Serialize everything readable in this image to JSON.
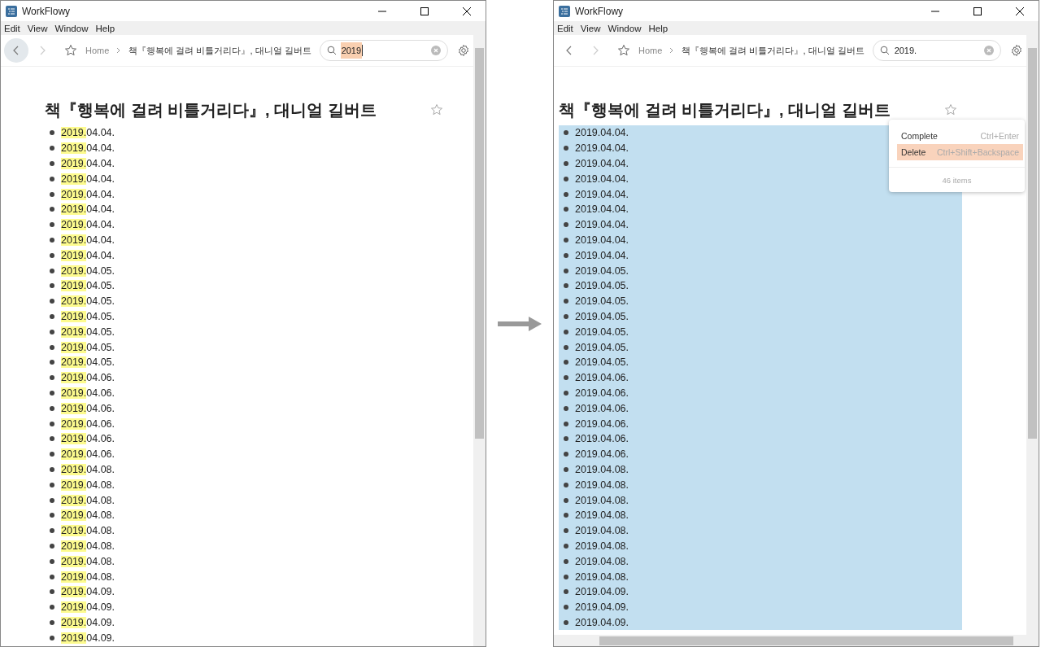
{
  "windows": [
    {
      "title": "WorkFlowy",
      "menu": [
        "Edit",
        "View",
        "Window",
        "Help"
      ],
      "back_hovered": true,
      "breadcrumb": [
        "Home",
        "책『행복에 걸려 비틀거리다』, 대니얼 길버트"
      ],
      "search": {
        "value": "2019",
        "text_selected": true
      },
      "h_scrollbar": false,
      "doc_title": "책『행복에 걸려 비틀거리다』, 대니얼 길버트",
      "items": [
        {
          "match": "2019.",
          "text": "04.04.",
          "selected": false
        },
        {
          "match": "2019.",
          "text": "04.04.",
          "selected": false
        },
        {
          "match": "2019.",
          "text": "04.04.",
          "selected": false
        },
        {
          "match": "2019.",
          "text": "04.04.",
          "selected": false
        },
        {
          "match": "2019.",
          "text": "04.04.",
          "selected": false
        },
        {
          "match": "2019.",
          "text": "04.04.",
          "selected": false
        },
        {
          "match": "2019.",
          "text": "04.04.",
          "selected": false
        },
        {
          "match": "2019.",
          "text": "04.04.",
          "selected": false
        },
        {
          "match": "2019.",
          "text": "04.04.",
          "selected": false
        },
        {
          "match": "2019.",
          "text": "04.05.",
          "selected": false
        },
        {
          "match": "2019.",
          "text": "04.05.",
          "selected": false
        },
        {
          "match": "2019.",
          "text": "04.05.",
          "selected": false
        },
        {
          "match": "2019.",
          "text": "04.05.",
          "selected": false
        },
        {
          "match": "2019.",
          "text": "04.05.",
          "selected": false
        },
        {
          "match": "2019.",
          "text": "04.05.",
          "selected": false
        },
        {
          "match": "2019.",
          "text": "04.05.",
          "selected": false
        },
        {
          "match": "2019.",
          "text": "04.06.",
          "selected": false
        },
        {
          "match": "2019.",
          "text": "04.06.",
          "selected": false
        },
        {
          "match": "2019.",
          "text": "04.06.",
          "selected": false
        },
        {
          "match": "2019.",
          "text": "04.06.",
          "selected": false
        },
        {
          "match": "2019.",
          "text": "04.06.",
          "selected": false
        },
        {
          "match": "2019.",
          "text": "04.06.",
          "selected": false
        },
        {
          "match": "2019.",
          "text": "04.08.",
          "selected": false
        },
        {
          "match": "2019.",
          "text": "04.08.",
          "selected": false
        },
        {
          "match": "2019.",
          "text": "04.08.",
          "selected": false
        },
        {
          "match": "2019.",
          "text": "04.08.",
          "selected": false
        },
        {
          "match": "2019.",
          "text": "04.08.",
          "selected": false
        },
        {
          "match": "2019.",
          "text": "04.08.",
          "selected": false
        },
        {
          "match": "2019.",
          "text": "04.08.",
          "selected": false
        },
        {
          "match": "2019.",
          "text": "04.08.",
          "selected": false
        },
        {
          "match": "2019.",
          "text": "04.09.",
          "selected": false
        },
        {
          "match": "2019.",
          "text": "04.09.",
          "selected": false
        },
        {
          "match": "2019.",
          "text": "04.09.",
          "selected": false
        },
        {
          "match": "2019.",
          "text": "04.09.",
          "selected": false
        }
      ]
    },
    {
      "title": "WorkFlowy",
      "menu": [
        "Edit",
        "View",
        "Window",
        "Help"
      ],
      "back_hovered": false,
      "breadcrumb": [
        "Home",
        "책『행복에 걸려 비틀거리다』, 대니얼 길버트"
      ],
      "search": {
        "value": "2019.",
        "text_selected": false
      },
      "h_scrollbar": true,
      "doc_title": "책『행복에 걸려 비틀거리다』, 대니얼 길버트",
      "items": [
        {
          "text": "2019.04.04.",
          "selected": true
        },
        {
          "text": "2019.04.04.",
          "selected": true
        },
        {
          "text": "2019.04.04.",
          "selected": true
        },
        {
          "text": "2019.04.04.",
          "selected": true
        },
        {
          "text": "2019.04.04.",
          "selected": true
        },
        {
          "text": "2019.04.04.",
          "selected": true
        },
        {
          "text": "2019.04.04.",
          "selected": true
        },
        {
          "text": "2019.04.04.",
          "selected": true
        },
        {
          "text": "2019.04.04.",
          "selected": true
        },
        {
          "text": "2019.04.05.",
          "selected": true
        },
        {
          "text": "2019.04.05.",
          "selected": true
        },
        {
          "text": "2019.04.05.",
          "selected": true
        },
        {
          "text": "2019.04.05.",
          "selected": true
        },
        {
          "text": "2019.04.05.",
          "selected": true
        },
        {
          "text": "2019.04.05.",
          "selected": true
        },
        {
          "text": "2019.04.05.",
          "selected": true
        },
        {
          "text": "2019.04.06.",
          "selected": true
        },
        {
          "text": "2019.04.06.",
          "selected": true
        },
        {
          "text": "2019.04.06.",
          "selected": true
        },
        {
          "text": "2019.04.06.",
          "selected": true
        },
        {
          "text": "2019.04.06.",
          "selected": true
        },
        {
          "text": "2019.04.06.",
          "selected": true
        },
        {
          "text": "2019.04.08.",
          "selected": true
        },
        {
          "text": "2019.04.08.",
          "selected": true
        },
        {
          "text": "2019.04.08.",
          "selected": true
        },
        {
          "text": "2019.04.08.",
          "selected": true
        },
        {
          "text": "2019.04.08.",
          "selected": true
        },
        {
          "text": "2019.04.08.",
          "selected": true
        },
        {
          "text": "2019.04.08.",
          "selected": true
        },
        {
          "text": "2019.04.08.",
          "selected": true
        },
        {
          "text": "2019.04.09.",
          "selected": true
        },
        {
          "text": "2019.04.09.",
          "selected": true
        },
        {
          "text": "2019.04.09.",
          "selected": true
        }
      ],
      "context_menu": {
        "options": [
          {
            "label": "Complete",
            "shortcut": "Ctrl+Enter",
            "selected": false
          },
          {
            "label": "Delete",
            "shortcut": "Ctrl+Shift+Backspace",
            "selected": true
          }
        ],
        "footer": "46 items"
      }
    }
  ]
}
